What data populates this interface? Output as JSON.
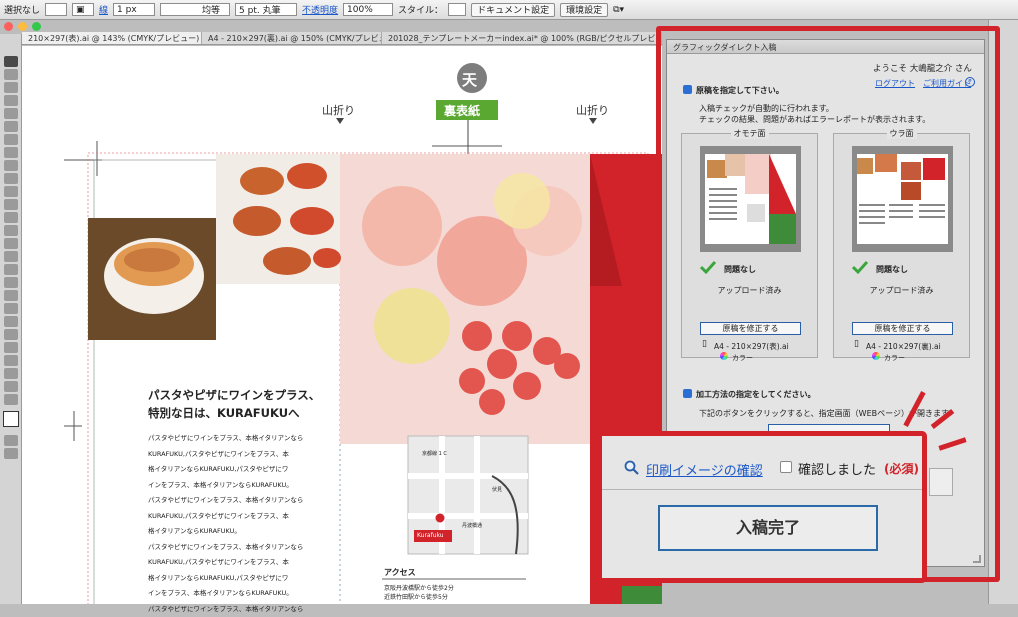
{
  "control_bar": {
    "selection": "選択なし",
    "stroke_label": "線",
    "stroke_weight": "1 px",
    "uniform": "均等",
    "brush": "5 pt. 丸筆",
    "opacity_label": "不透明度",
    "opacity_value": "100%",
    "style_label": "スタイル：",
    "document_settings": "ドキュメント設定",
    "preferences": "環境設定"
  },
  "tabs": [
    {
      "label": "210×297(表).ai @ 143% (CMYK/プレビュー)"
    },
    {
      "label": "A4 - 210×297(裏).ai @ 150% (CMYK/プレビュー)"
    },
    {
      "label": "201028_テンプレートメーカーindex.ai* @ 100% (RGB/ピクセルプレビュー)"
    }
  ],
  "canvas": {
    "top_marker": "天",
    "back_cover": "裏表紙",
    "fold_left": "山折り",
    "fold_right": "山折り",
    "headline_1": "パスタやピザにワインをプラス、",
    "headline_2": "特別な日は、KURAFUKUへ",
    "body_lines": [
      "パスタやピザにワインをプラス、本格イタリアンなら",
      "KURAFUKU,パスタやピザにワインをプラス、本",
      "格イタリアンならKURAFUKU,パスタやピザにワ",
      "インをプラス、本格イタリアンならKURAFUKU。",
      "パスタやピザにワインをプラス、本格イタリアンなら",
      "KURAFUKU,パスタやピザにワインをプラス、本",
      "格イタリアンならKURAFUKU。",
      "パスタやピザにワインをプラス、本格イタリアンなら",
      "KURAFUKU,パスタやピザにワインをプラス、本",
      "格イタリアンならKURAFUKU,パスタやピザにワ",
      "インをプラス、本格イタリアンならKURAFUKU。",
      "パスタやピザにワインをプラス、本格イタリアンなら"
    ],
    "map_station": "京都線 1 C",
    "map_street_1": "丹波橋通",
    "map_street_2": "伏見",
    "map_shop": "Kurafuku",
    "access_title": "アクセス",
    "access_1": "京阪丹波橋駅から徒歩2分",
    "access_2": "近鉄竹田駅から徒歩5分"
  },
  "dialog": {
    "title": "グラフィックダイレクト入稿",
    "welcome": "ようこそ 大嶋龍之介 さん",
    "logout": "ログアウト",
    "guide": "ご利用ガイド",
    "step1": "原稿を指定して下さい。",
    "desc1": "入稿チェックが自動的に行われます。",
    "desc2": "チェックの結果、問題があればエラーレポートが表示されます。",
    "front": {
      "label": "オモテ面",
      "status": "問題なし",
      "uploaded": "アップロード済み",
      "fix": "原稿を修正する",
      "file": "A4 - 210×297(表).ai",
      "color": "カラー"
    },
    "back": {
      "label": "ウラ面",
      "status": "問題なし",
      "uploaded": "アップロード済み",
      "fix": "原稿を修正する",
      "file": "A4 - 210×297(裏).ai",
      "color": "カラー"
    },
    "step2": "加工方法の指定をしてください。",
    "desc3": "下記のボタンをクリックすると、指定画面（WEBページ）が開きます"
  },
  "callout": {
    "preview_link": "印刷イメージの確認",
    "confirm_label": "確認しました",
    "required": "(必須)",
    "submit": "入稿完了"
  },
  "colors": {
    "accent_red": "#d2232a",
    "link_blue": "#1a57c8",
    "green_label": "#5aa832"
  }
}
